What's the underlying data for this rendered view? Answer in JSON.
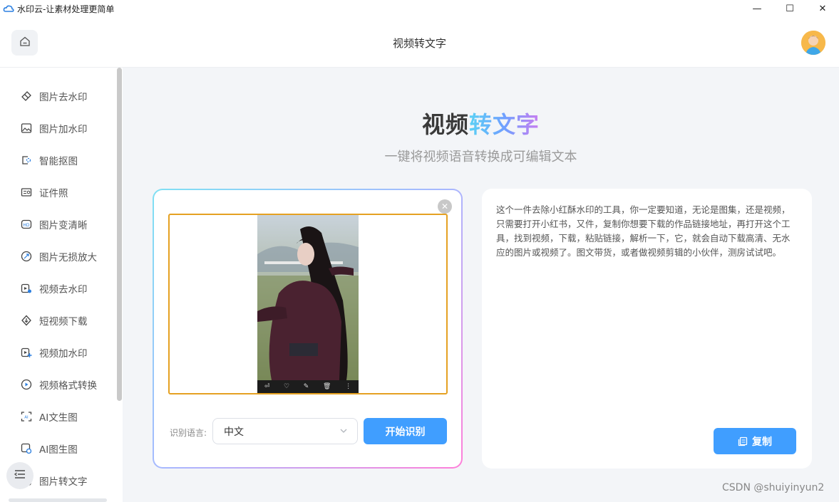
{
  "window": {
    "title": "水印云-让素材处理更简单",
    "controls": {
      "minimize": "—",
      "maximize": "☐",
      "close": "✕"
    }
  },
  "header": {
    "title": "视频转文字"
  },
  "sidebar": {
    "items": [
      {
        "label": "图片去水印",
        "icon": "eraser-icon"
      },
      {
        "label": "图片加水印",
        "icon": "image-icon"
      },
      {
        "label": "智能抠图",
        "icon": "cutout-icon"
      },
      {
        "label": "证件照",
        "icon": "id-card-icon"
      },
      {
        "label": "图片变清晰",
        "icon": "hd-icon"
      },
      {
        "label": "图片无损放大",
        "icon": "enlarge-icon"
      },
      {
        "label": "视频去水印",
        "icon": "video-eraser-icon"
      },
      {
        "label": "短视频下载",
        "icon": "download-icon"
      },
      {
        "label": "视频加水印",
        "icon": "video-add-icon"
      },
      {
        "label": "视频格式转换",
        "icon": "play-circle-icon"
      },
      {
        "label": "AI文生图",
        "icon": "ai-text-image-icon"
      },
      {
        "label": "AI图生图",
        "icon": "ai-image-image-icon"
      },
      {
        "label": "图片转文字",
        "icon": "ocr-icon"
      }
    ]
  },
  "main": {
    "title_part1": "视频",
    "title_part2": "转文字",
    "subtitle": "一键将视频语音转换成可编辑文本",
    "language_label": "识别语言:",
    "language_value": "中文",
    "start_button": "开始识别",
    "video_controls": [
      "⏎",
      "♡",
      "✎",
      "🗑",
      "⋮"
    ],
    "result_text": "这个一件去除小红酥水印的工具，你一定要知道，无论是图集，还是视频，只需要打开小红书，又件，复制你想要下载的作品链接地址，再打开这个工具，找到视频，下载，粘贴链接，解析一下，它，就会自动下载高清、无水应的图片或视频了。图文带货，或者做视频剪辑的小伙伴，测房试试吧。",
    "copy_button": "复制"
  },
  "watermark": "CSDN @shuiyinyun2",
  "colors": {
    "primary": "#409eff",
    "video_border": "#e5a122",
    "gradient_start": "#5ad0f5",
    "gradient_end": "#c97cf0"
  }
}
